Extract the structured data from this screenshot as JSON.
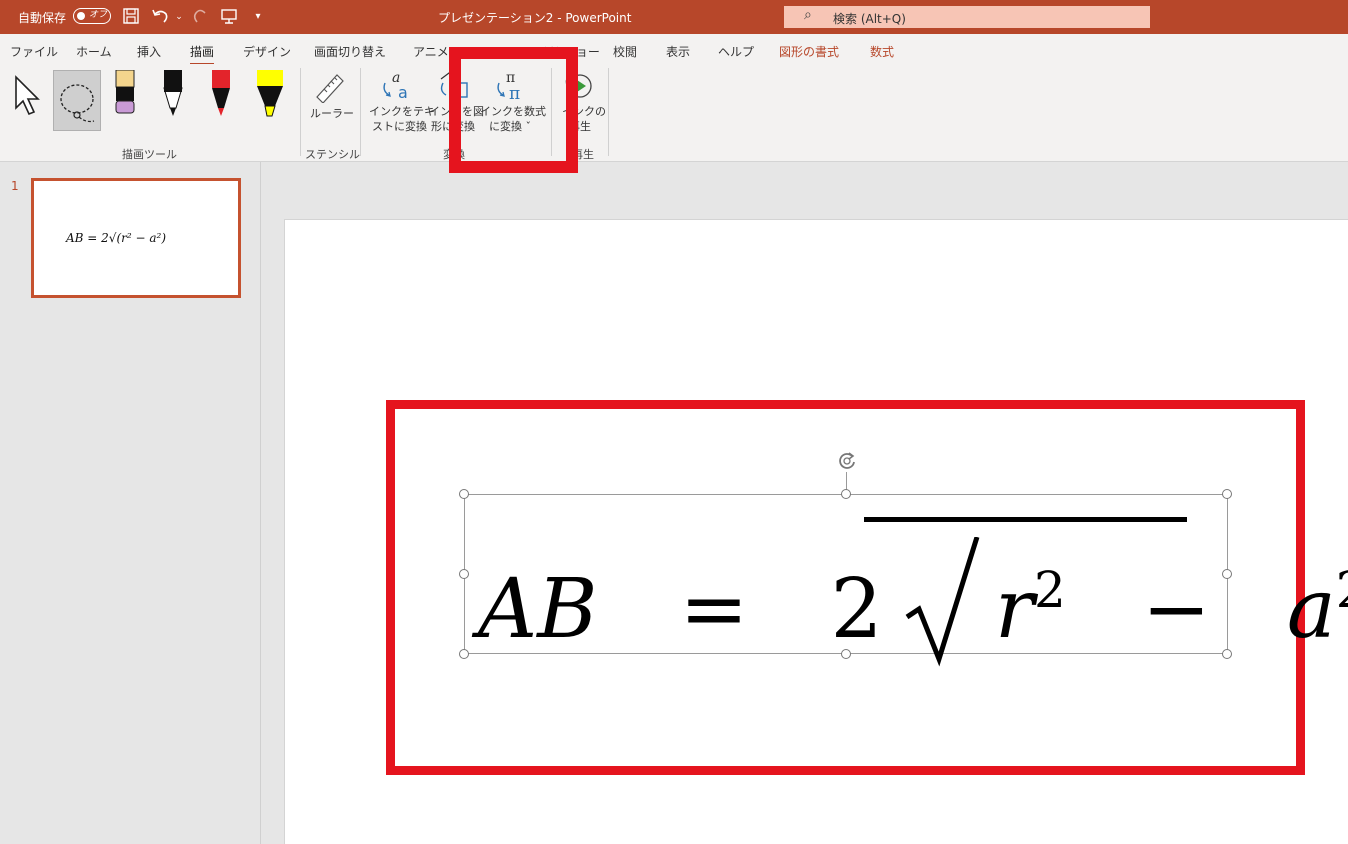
{
  "titlebar": {
    "autosave_label": "自動保存",
    "autosave_state": "オフ",
    "doc_title": "プレゼンテーション2  -  PowerPoint",
    "search_placeholder": "検索 (Alt+Q)"
  },
  "ribbon_tabs": [
    {
      "label": "ファイル"
    },
    {
      "label": "ホーム"
    },
    {
      "label": "挿入"
    },
    {
      "label": "描画"
    },
    {
      "label": "デザイン"
    },
    {
      "label": "画面切り替え"
    },
    {
      "label": "アニメーション"
    },
    {
      "label": "スライド ショー"
    },
    {
      "label": "校閲"
    },
    {
      "label": "表示"
    },
    {
      "label": "ヘルプ"
    },
    {
      "label": "図形の書式"
    },
    {
      "label": "数式"
    }
  ],
  "ribbon": {
    "groups": {
      "draw_tools": "描画ツール",
      "stencil": "ステンシル",
      "convert": "変換",
      "replay": "再生"
    },
    "ruler_label": "ルーラー",
    "ink_to_text_line1": "インクをテキ",
    "ink_to_text_line2": "ストに変換",
    "ink_to_shape_line1": "インクを図",
    "ink_to_shape_line2": "形に変換",
    "ink_to_math_line1": "インクを数式",
    "ink_to_math_line2": "に変換 ˇ",
    "ink_replay_line1": "インクの",
    "ink_replay_line2": "再生"
  },
  "thumbnails": [
    {
      "number": "1",
      "equation": "AB = 2√(r² − a²)"
    }
  ],
  "equation": {
    "lhs": "AB",
    "equals": "=",
    "coef": "2",
    "r": "r",
    "minus": "−",
    "a": "a",
    "exp": "2"
  },
  "colors": {
    "brand": "#b7472a",
    "highlight": "#e5141e"
  }
}
